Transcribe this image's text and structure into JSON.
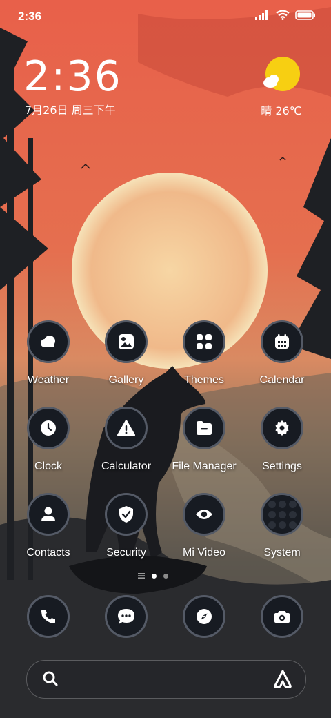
{
  "status_bar": {
    "time": "2:36",
    "icons": [
      "signal-icon",
      "wifi-icon",
      "battery-icon"
    ]
  },
  "clock_widget": {
    "time": "2:36",
    "date": "7月26日 周三下午"
  },
  "weather_widget": {
    "icon": "sun-cloud-icon",
    "text": "晴 26℃"
  },
  "apps": [
    {
      "label": "Weather",
      "icon": "weather-icon"
    },
    {
      "label": "Gallery",
      "icon": "gallery-icon"
    },
    {
      "label": "Themes",
      "icon": "themes-icon"
    },
    {
      "label": "Calendar",
      "icon": "calendar-icon"
    },
    {
      "label": "Clock",
      "icon": "clock-icon"
    },
    {
      "label": "Calculator",
      "icon": "calculator-icon"
    },
    {
      "label": "File Manager",
      "icon": "file-manager-icon"
    },
    {
      "label": "Settings",
      "icon": "settings-icon"
    },
    {
      "label": "Contacts",
      "icon": "contacts-icon"
    },
    {
      "label": "Security",
      "icon": "security-icon"
    },
    {
      "label": "Mi Video",
      "icon": "mi-video-icon"
    },
    {
      "label": "System",
      "icon": "system-folder-icon"
    }
  ],
  "dock": [
    {
      "icon": "phone-icon"
    },
    {
      "icon": "messages-icon"
    },
    {
      "icon": "browser-icon"
    },
    {
      "icon": "camera-icon"
    }
  ],
  "page_indicator": {
    "pages": 2,
    "current": 1
  },
  "search_bar": {
    "left_icon": "search-icon",
    "right_icon": "assistant-icon"
  },
  "colors": {
    "sky_top": "#e8604a",
    "moon": "#f6cf9a",
    "icon_bg": "#171b22",
    "icon_ring": "#545a66",
    "sun": "#f7cf12"
  }
}
